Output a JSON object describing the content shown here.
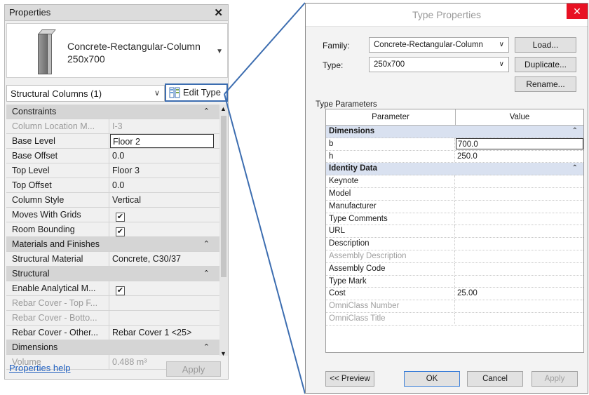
{
  "properties": {
    "title": "Properties",
    "close_glyph": "✕",
    "type_name_line1": "Concrete-Rectangular-Column",
    "type_name_line2": "250x700",
    "instance_selector": "Structural Columns (1)",
    "edit_type_label": "Edit Type",
    "rows": [
      {
        "kind": "group",
        "label": "Constraints",
        "collapse": "⌃"
      },
      {
        "kind": "prop",
        "label": "Column Location M...",
        "value": "I-3",
        "dim": true
      },
      {
        "kind": "prop",
        "label": "Base Level",
        "value": "Floor 2",
        "active": true
      },
      {
        "kind": "prop",
        "label": "Base Offset",
        "value": "0.0"
      },
      {
        "kind": "prop",
        "label": "Top Level",
        "value": "Floor 3"
      },
      {
        "kind": "prop",
        "label": "Top Offset",
        "value": "0.0"
      },
      {
        "kind": "prop",
        "label": "Column Style",
        "value": "Vertical"
      },
      {
        "kind": "check",
        "label": "Moves With Grids",
        "checked": true
      },
      {
        "kind": "check",
        "label": "Room Bounding",
        "checked": true
      },
      {
        "kind": "group",
        "label": "Materials and Finishes",
        "collapse": "⌃"
      },
      {
        "kind": "prop",
        "label": "Structural Material",
        "value": "Concrete, C30/37"
      },
      {
        "kind": "group",
        "label": "Structural",
        "collapse": "⌃"
      },
      {
        "kind": "check",
        "label": "Enable Analytical M...",
        "checked": true
      },
      {
        "kind": "prop",
        "label": "Rebar Cover - Top F...",
        "value": "",
        "dim": true
      },
      {
        "kind": "prop",
        "label": "Rebar Cover - Botto...",
        "value": "",
        "dim": true
      },
      {
        "kind": "prop",
        "label": "Rebar Cover - Other...",
        "value": "Rebar Cover 1 <25>"
      },
      {
        "kind": "group",
        "label": "Dimensions",
        "collapse": "⌃"
      },
      {
        "kind": "prop",
        "label": "Volume",
        "value": "0.488 m³",
        "dim": true
      }
    ],
    "help_link": "Properties help",
    "apply_label": "Apply"
  },
  "type_dialog": {
    "title": "Type Properties",
    "close_glyph": "✕",
    "family_label": "Family:",
    "family_value": "Concrete-Rectangular-Column",
    "type_label": "Type:",
    "type_value": "250x700",
    "load_label": "Load...",
    "duplicate_label": "Duplicate...",
    "rename_label": "Rename...",
    "type_parameters_label": "Type Parameters",
    "col_parameter": "Parameter",
    "col_value": "Value",
    "rows": [
      {
        "kind": "group",
        "label": "Dimensions"
      },
      {
        "kind": "prop",
        "label": "b",
        "value": "700.0",
        "active": true
      },
      {
        "kind": "prop",
        "label": "h",
        "value": "250.0"
      },
      {
        "kind": "group",
        "label": "Identity Data"
      },
      {
        "kind": "prop",
        "label": "Keynote",
        "value": ""
      },
      {
        "kind": "prop",
        "label": "Model",
        "value": ""
      },
      {
        "kind": "prop",
        "label": "Manufacturer",
        "value": ""
      },
      {
        "kind": "prop",
        "label": "Type Comments",
        "value": ""
      },
      {
        "kind": "prop",
        "label": "URL",
        "value": ""
      },
      {
        "kind": "prop",
        "label": "Description",
        "value": ""
      },
      {
        "kind": "prop",
        "label": "Assembly Description",
        "value": "",
        "dim": true
      },
      {
        "kind": "prop",
        "label": "Assembly Code",
        "value": ""
      },
      {
        "kind": "prop",
        "label": "Type Mark",
        "value": ""
      },
      {
        "kind": "prop",
        "label": "Cost",
        "value": "25.00"
      },
      {
        "kind": "prop",
        "label": "OmniClass Number",
        "value": "",
        "dim": true
      },
      {
        "kind": "prop",
        "label": "OmniClass Title",
        "value": "",
        "dim": true
      }
    ],
    "preview_label": "<< Preview",
    "ok_label": "OK",
    "cancel_label": "Cancel",
    "apply_label": "Apply"
  },
  "colors": {
    "highlight_border": "#3c6db0",
    "close_red": "#e81123",
    "group_blue": "#d9e1f0"
  }
}
